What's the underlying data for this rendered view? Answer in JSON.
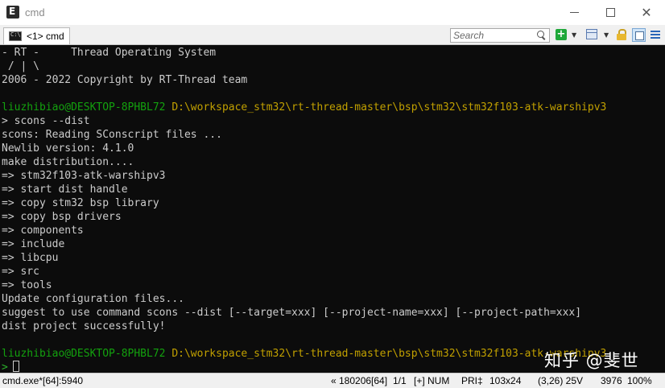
{
  "window": {
    "title": "cmd"
  },
  "tab": {
    "label": "<1> cmd"
  },
  "search": {
    "placeholder": "Search"
  },
  "toolbar": {
    "add_symbol": "+",
    "dropdown_symbol": "▼"
  },
  "console": {
    "banner": [
      "- RT -     Thread Operating System",
      " / | \\",
      "2006 - 2022 Copyright by RT-Thread team"
    ],
    "prompt": {
      "user": "liuzhibiao@DESKTOP-8PHBL72",
      "path": "D:\\workspace_stm32\\rt-thread-master\\bsp\\stm32\\stm32f103-atk-warshipv3"
    },
    "command": "> scons --dist",
    "output": [
      "scons: Reading SConscript files ...",
      "Newlib version: 4.1.0",
      "make distribution....",
      "=> stm32f103-atk-warshipv3",
      "=> start dist handle",
      "=> copy stm32 bsp library",
      "=> copy bsp drivers",
      "=> components",
      "=> include",
      "=> libcpu",
      "=> src",
      "=> tools",
      "Update configuration files...",
      "suggest to use command scons --dist [--target=xxx] [--project-name=xxx] [--project-path=xxx]",
      "dist project successfully!"
    ],
    "prompt_caret": ">",
    "watermark": "知乎 @斐世"
  },
  "statusbar": {
    "process": "cmd.exe*[64]:5940",
    "build": "« 180206[64]",
    "console_index": "1/1",
    "insert_mode": "[+] NUM",
    "priority": "PRI‡",
    "size": "103x24",
    "cursor_pos": "(3,26) 25V",
    "chars": "3976",
    "zoom": "100%"
  },
  "colors": {
    "console_bg": "#0c0c0c",
    "console_text": "#cccccc",
    "prompt_user": "#13a10e",
    "prompt_path": "#c1a000"
  }
}
